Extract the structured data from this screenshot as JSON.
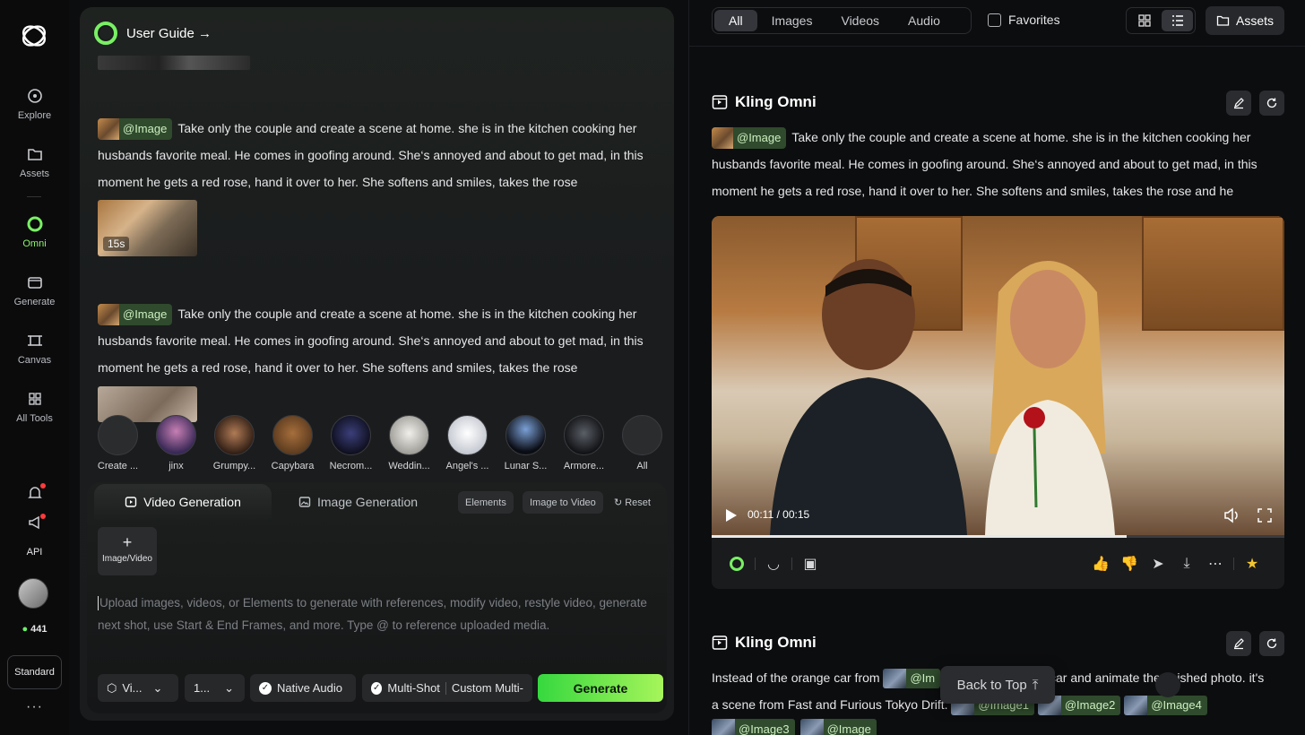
{
  "rail": {
    "items": [
      {
        "label": "Explore"
      },
      {
        "label": "Assets"
      },
      {
        "label": "Omni"
      },
      {
        "label": "Generate"
      },
      {
        "label": "Canvas"
      },
      {
        "label": "All Tools"
      }
    ],
    "api_label": "API",
    "credits": "441",
    "plan": "Standard",
    "more": "···"
  },
  "center": {
    "guide_label": "User Guide →",
    "messages": [
      {
        "tag": "@Image",
        "text": "Take only the couple and create a scene at home. she is in the kitchen cooking her husbands favorite meal. He comes in goofing around. She‘s annoyed and about to get mad, in this moment he gets a red rose, hand it over to her. She softens and smiles, takes the rose",
        "duration": "15s"
      },
      {
        "tag": "@Image",
        "text": "Take only the couple and create a scene at home. she is in the kitchen cooking her husbands favorite meal. He comes in goofing around. She‘s annoyed and about to get mad, in this moment he gets a red rose, hand it over to her. She softens and smiles, takes the rose"
      }
    ],
    "characters": [
      {
        "label": "Create ..."
      },
      {
        "label": "jinx"
      },
      {
        "label": "Grumpy..."
      },
      {
        "label": "Capybara"
      },
      {
        "label": "Necrom..."
      },
      {
        "label": "Weddin..."
      },
      {
        "label": "Angel's ..."
      },
      {
        "label": "Lunar S..."
      },
      {
        "label": "Armore..."
      },
      {
        "label": "All"
      }
    ],
    "composer": {
      "tab_video": "Video Generation",
      "tab_image": "Image Generation",
      "elements": "Elements",
      "image_to_video": "Image to Video",
      "reset": "Reset",
      "upload_label": "Image/Video",
      "placeholder": "Upload images, videos, or Elements to generate with references, modify video, restyle video, generate next shot, use Start & End Frames, and more. Type @ to reference uploaded media.",
      "model": "Vi...",
      "ratio": "1...",
      "native_audio": "Native Audio",
      "multi_shot": "Multi-Shot",
      "custom_multi": "Custom Multi-",
      "generate": "Generate"
    }
  },
  "right": {
    "filters": [
      {
        "label": "All",
        "active": true
      },
      {
        "label": "Images",
        "active": false
      },
      {
        "label": "Videos",
        "active": false
      },
      {
        "label": "Audio",
        "active": false
      }
    ],
    "favorites_label": "Favorites",
    "assets_label": "Assets",
    "card1": {
      "title": "Kling Omni",
      "tag": "@Image",
      "text": "Take only the couple and create a scene at home. she is in the kitchen cooking her husbands favorite meal. He comes in goofing around. She‘s annoyed and about to get mad, in this moment he gets a red rose, hand it over to her. She softens and smiles, takes the rose and he",
      "time": "00:11 / 00:15",
      "progress": 0.725
    },
    "card2": {
      "title": "Kling Omni",
      "text_pre": "Instead of the orange car from",
      "tag_first": "@Im",
      "text_mid": "car and animate the finished photo. it's",
      "line2_pre": "a scene from Fast and Furious Tokyo Drift.",
      "tags": [
        "@Image1",
        "@Image2",
        "@Image4"
      ],
      "tags_row3": [
        "@Image3",
        "@Image"
      ]
    },
    "back_to_top": "Back to Top"
  },
  "colors": {
    "accent": "#79f064",
    "tag_bg": "#2f4a2c",
    "generate_start": "#36d83f",
    "generate_end": "#a6f55a"
  }
}
